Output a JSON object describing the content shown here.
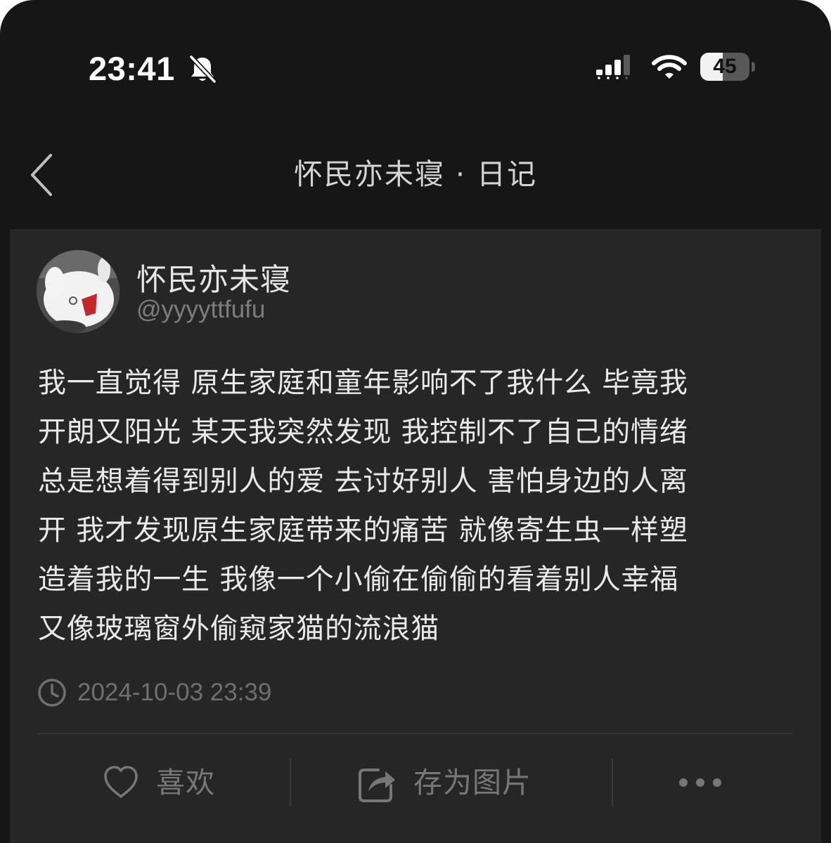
{
  "status_bar": {
    "time": "23:41",
    "battery": "45",
    "battery_level": 0.45
  },
  "nav": {
    "title": "怀民亦未寝 · 日记"
  },
  "post": {
    "author": {
      "name": "怀民亦未寝",
      "handle": "@yyyyttfufu"
    },
    "body_lines": [
      "我一直觉得 原生家庭和童年影响不了我什么 毕竟我",
      "开朗又阳光 某天我突然发现 我控制不了自己的情绪",
      "总是想着得到别人的爱 去讨好别人 害怕身边的人离",
      "开 我才发现原生家庭带来的痛苦 就像寄生虫一样塑",
      "造着我的一生 我像一个小偷在偷偷的看着别人幸福",
      "又像玻璃窗外偷窥家猫的流浪猫"
    ],
    "timestamp": "2024-10-03 23:39"
  },
  "actions": {
    "like_label": "喜欢",
    "save_label": "存为图片"
  },
  "colors": {
    "background": "#161616",
    "card": "#262626",
    "text_primary": "#e9e9e9",
    "text_muted": "#777777"
  },
  "icons": {
    "back": "chevron-left-icon",
    "mute": "bell-slash-icon",
    "signal": "cellular-signal-icon",
    "wifi": "wifi-icon",
    "clock": "clock-icon",
    "like": "heart-icon",
    "save": "share-square-icon",
    "more": "more-dots-icon"
  }
}
